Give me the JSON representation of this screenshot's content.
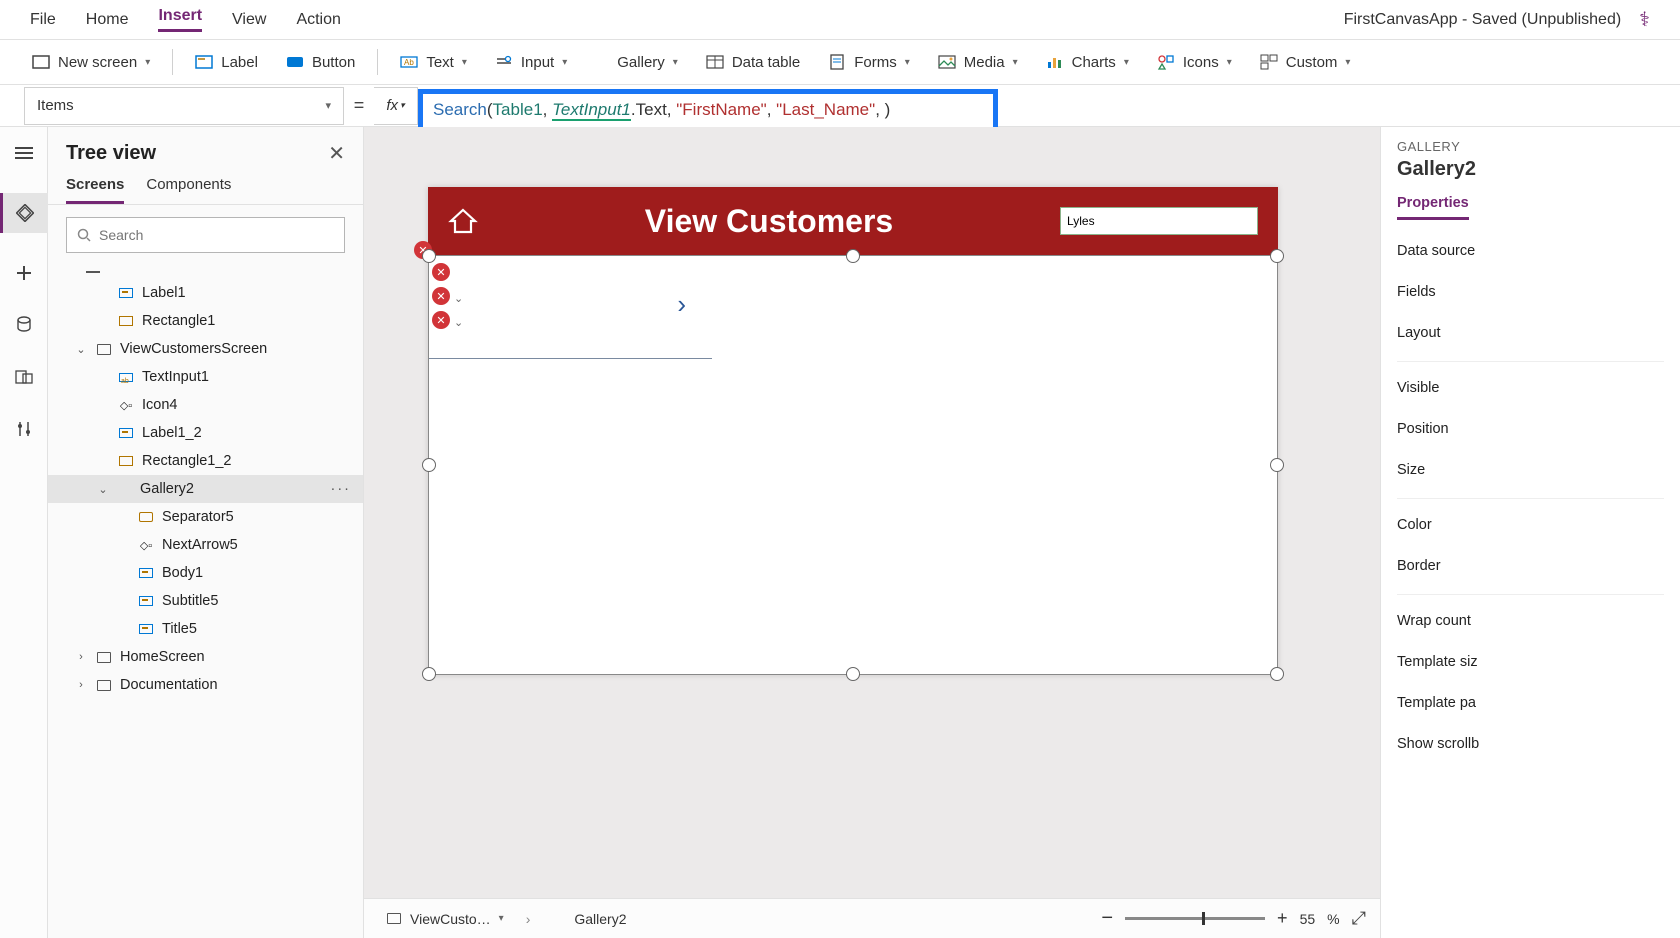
{
  "top_menu": {
    "items": [
      "File",
      "Home",
      "Insert",
      "View",
      "Action"
    ],
    "active_index": 2,
    "app_title": "FirstCanvasApp - Saved (Unpublished)"
  },
  "ribbon": {
    "new_screen": "New screen",
    "label_btn": "Label",
    "button_btn": "Button",
    "text": "Text",
    "input": "Input",
    "gallery": "Gallery",
    "data_table": "Data table",
    "forms": "Forms",
    "media": "Media",
    "charts": "Charts",
    "icons": "Icons",
    "custom": "Custom"
  },
  "formula": {
    "property": "Items",
    "fx": "fx",
    "tokens": {
      "search_fn": "Search",
      "open": "(",
      "table": "Table1",
      "comma1": ", ",
      "textinput": "TextInput1",
      "dot_text": ".Text",
      "comma2": ", ",
      "str1": "\"FirstName\"",
      "comma3": ", ",
      "str2": "\"Last_Name\"",
      "comma4": ", ",
      "close": ")"
    }
  },
  "tree": {
    "title": "Tree view",
    "tabs": {
      "screens": "Screens",
      "components": "Components"
    },
    "search_placeholder": "Search",
    "items": {
      "label1": "Label1",
      "rectangle1": "Rectangle1",
      "viewcustomers": "ViewCustomersScreen",
      "textinput1": "TextInput1",
      "icon4": "Icon4",
      "label1_2": "Label1_2",
      "rectangle1_2": "Rectangle1_2",
      "gallery2": "Gallery2",
      "separator5": "Separator5",
      "nextarrow5": "NextArrow5",
      "body1": "Body1",
      "subtitle5": "Subtitle5",
      "title5": "Title5",
      "homescreen": "HomeScreen",
      "documentation": "Documentation"
    },
    "more": "···"
  },
  "canvas": {
    "header_title": "View Customers",
    "search_value": "Lyles"
  },
  "status_bar": {
    "crumb1": "ViewCusto…",
    "crumb2": "Gallery2",
    "zoom_value": "55",
    "zoom_pct": "%"
  },
  "prop_panel": {
    "type_label": "GALLERY",
    "name": "Gallery2",
    "tab": "Properties",
    "rows": {
      "datasource": "Data source",
      "fields": "Fields",
      "layout": "Layout",
      "visible": "Visible",
      "position": "Position",
      "size": "Size",
      "color": "Color",
      "border": "Border",
      "wrapcount": "Wrap count",
      "templatesize": "Template siz",
      "templatepad": "Template pa",
      "showscroll": "Show scrollb"
    }
  }
}
